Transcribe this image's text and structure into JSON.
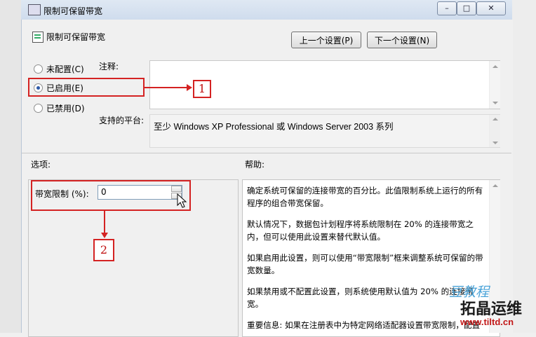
{
  "window": {
    "title": "限制可保留带宽",
    "controls": [
      "–",
      "□",
      "✕"
    ]
  },
  "header": {
    "title": "限制可保留带宽",
    "prev_button": "上一个设置(P)",
    "next_button": "下一个设置(N)"
  },
  "state": {
    "options": [
      {
        "label": "未配置(C)",
        "selected": false
      },
      {
        "label": "已启用(E)",
        "selected": true
      },
      {
        "label": "已禁用(D)",
        "selected": false
      }
    ]
  },
  "comment": {
    "label": "注释:",
    "value": ""
  },
  "platform": {
    "label": "支持的平台:",
    "value": "至少 Windows XP Professional 或 Windows Server 2003 系列"
  },
  "options_section": {
    "heading": "选项:",
    "bandwidth_label": "带宽限制 (%):",
    "bandwidth_value": "0"
  },
  "help_section": {
    "heading": "帮助:",
    "paragraphs": [
      "确定系统可保留的连接带宽的百分比。此值限制系统上运行的所有程序的组合带宽保留。",
      "默认情况下，数据包计划程序将系统限制在 20% 的连接带宽之内，但可以使用此设置来替代默认值。",
      "如果启用此设置，则可以使用“带宽限制”框来调整系统可保留的带宽数量。",
      "如果禁用或不配置此设置，则系统使用默认值为 20% 的连接带宽。",
      "重要信息: 如果在注册表中为特定网络适配器设置带宽限制，配置"
    ]
  },
  "annotations": {
    "callout_1": "1",
    "callout_2": "2"
  },
  "watermark": {
    "line1": "拓晶运维",
    "line2": "www.tiltd.cn",
    "brand": "豆教程"
  },
  "colors": {
    "annotation_red": "#d42222",
    "titlebar": "#dfe8f3"
  }
}
